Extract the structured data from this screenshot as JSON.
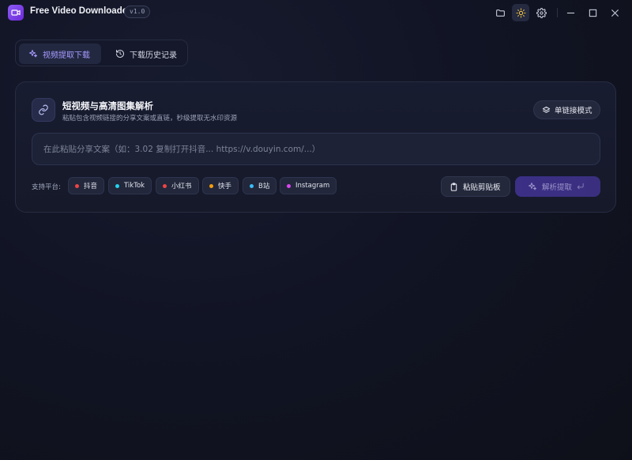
{
  "app": {
    "title": "Free Video Downloader",
    "version": "v1.0"
  },
  "titlebar": {
    "icons": [
      "folder-icon",
      "sun-icon",
      "gear-icon"
    ],
    "window_controls": [
      "minimize-icon",
      "maximize-icon",
      "close-icon"
    ]
  },
  "tabs": [
    {
      "label": "视频提取下载",
      "icon": "sparkles-icon",
      "active": true
    },
    {
      "label": "下载历史记录",
      "icon": "history-icon",
      "active": false
    }
  ],
  "card": {
    "title": "短视频与高清图集解析",
    "subtitle": "粘贴包含视频链接的分享文案或直链，秒级提取无水印资源",
    "mode_button": "单链接模式",
    "input": {
      "value": "",
      "placeholder": "在此粘贴分享文案（如：3.02 复制打开抖音... https://v.douyin.com/...）"
    },
    "platforms_label": "支持平台:",
    "platforms": [
      {
        "name": "抖音",
        "color": "#ef4444"
      },
      {
        "name": "TikTok",
        "color": "#22d3ee"
      },
      {
        "name": "小红书",
        "color": "#ef4444"
      },
      {
        "name": "快手",
        "color": "#f59e0b"
      },
      {
        "name": "B站",
        "color": "#38bdf8"
      },
      {
        "name": "Instagram",
        "color": "#d946ef"
      }
    ],
    "paste_button": "粘贴剪贴板",
    "parse_button": "解析提取"
  },
  "colors": {
    "accent": "#8b5cf6",
    "background": "#111424"
  }
}
